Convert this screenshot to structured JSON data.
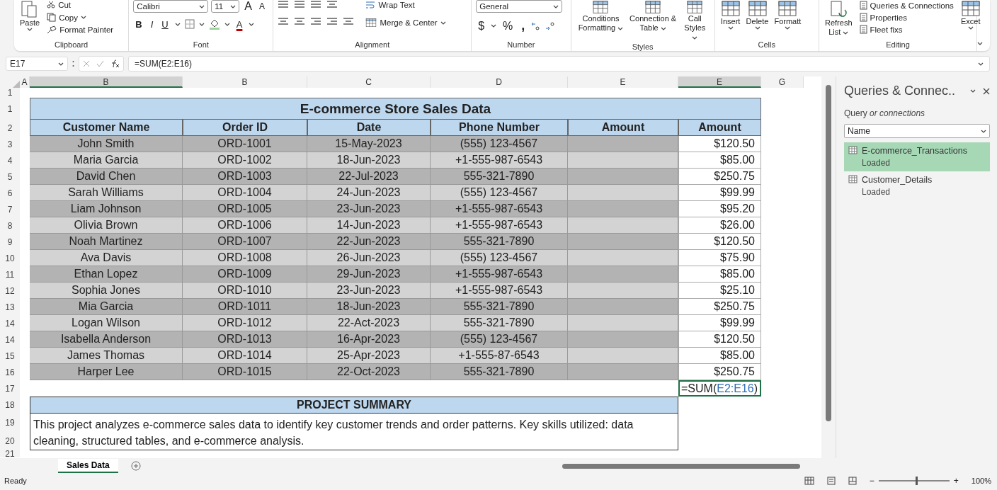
{
  "ribbon": {
    "clipboard": {
      "label": "Clipboard",
      "paste": "Paste",
      "cut": "Cut",
      "copy": "Copy",
      "format_painter": "Format Painter"
    },
    "font": {
      "label": "Font",
      "family": "Calibri",
      "size": "11",
      "grow": "A",
      "shrink": "A",
      "bold": "B",
      "italic": "I",
      "underline": "U",
      "font_color": "A"
    },
    "alignment": {
      "label": "Alignment",
      "wrap_text": "Wrap Text",
      "merge": "Merge & Center"
    },
    "number": {
      "label": "Number",
      "format": "General",
      "currency": "$",
      "percent": "%",
      "comma": ","
    },
    "styles": {
      "label": "Styles",
      "buttons": [
        "Conditions Formatting",
        "Connection & Table",
        "Call Styles"
      ]
    },
    "cells": {
      "label": "Cells",
      "buttons": [
        "Insert",
        "Delete",
        "Formatt"
      ]
    },
    "editing": {
      "label": "Editing",
      "refresh": "Refresh List",
      "links": [
        "Queries & Connections",
        "Properties",
        "Fleet fixs"
      ],
      "extra": "Excet"
    }
  },
  "formula_bar": {
    "name_box": "E17",
    "formula": "=SUM(E2:E16)"
  },
  "sheet": {
    "columns": [
      {
        "label": "A",
        "selected": false
      },
      {
        "label": "B",
        "selected": true
      },
      {
        "label": "B",
        "selected": false
      },
      {
        "label": "C",
        "selected": false
      },
      {
        "label": "D",
        "selected": false
      },
      {
        "label": "E",
        "selected": false
      },
      {
        "label": "E",
        "selected": true
      },
      {
        "label": "G",
        "selected": false
      }
    ],
    "blank_row": "1",
    "title_row": "1",
    "header_row": "2",
    "title": "E-commerce Store Sales Data",
    "headers": [
      "Customer Name",
      "Order ID",
      "Date",
      "Phone Number",
      "Amount",
      "Amount"
    ],
    "rows": [
      {
        "row": "3",
        "name": "John Smith",
        "order_id": "ORD-1001",
        "date": "15-May-2023",
        "phone": "(555) 123-4567",
        "amount": "$120.50"
      },
      {
        "row": "4",
        "name": "Maria Garcia",
        "order_id": "ORD-1002",
        "date": "18-Jun-2023",
        "phone": "+1-555-987-6543",
        "amount": "$85.00"
      },
      {
        "row": "5",
        "name": "David Chen",
        "order_id": "ORD-1003",
        "date": "22-Jul-2023",
        "phone": "555-321-7890",
        "amount": "$250.75"
      },
      {
        "row": "6",
        "name": "Sarah Williams",
        "order_id": "ORD-1004",
        "date": "24-Jun-2023",
        "phone": "(555) 123-4567",
        "amount": "$99.99"
      },
      {
        "row": "7",
        "name": "Liam Johnson",
        "order_id": "ORD-1005",
        "date": "23-Jun-2023",
        "phone": "+1-555-987-6543",
        "amount": "$95.20"
      },
      {
        "row": "8",
        "name": "Olivia Brown",
        "order_id": "ORD-1006",
        "date": "14-Jun-2023",
        "phone": "+1-555-987-6543",
        "amount": "$26.00"
      },
      {
        "row": "9",
        "name": "Noah Martinez",
        "order_id": "ORD-1007",
        "date": "22-Jun-2023",
        "phone": "555-321-7890",
        "amount": "$120.50"
      },
      {
        "row": "10",
        "name": "Ava Davis",
        "order_id": "ORD-1008",
        "date": "26-Jun-2023",
        "phone": "(555) 123-4567",
        "amount": "$75.90"
      },
      {
        "row": "11",
        "name": "Ethan Lopez",
        "order_id": "ORD-1009",
        "date": "29-Jun-2023",
        "phone": "+1-555-987-6543",
        "amount": "$85.00"
      },
      {
        "row": "12",
        "name": "Sophia Jones",
        "order_id": "ORD-1010",
        "date": "23-Jun-2023",
        "phone": "+1-555-987-6543",
        "amount": "$25.10"
      },
      {
        "row": "13",
        "name": "Mia Garcia",
        "order_id": "ORD-1011",
        "date": "18-Jun-2023",
        "phone": "555-321-7890",
        "amount": "$250.75"
      },
      {
        "row": "14",
        "name": "Logan Wilson",
        "order_id": "ORD-1012",
        "date": "22-Act-2023",
        "phone": "555-321-7890",
        "amount": "$99.99"
      },
      {
        "row": "14",
        "name": "Isabella Anderson",
        "order_id": "ORD-1013",
        "date": "16-Apr-2023",
        "phone": "(555) 123-4567",
        "amount": "$120.50"
      },
      {
        "row": "15",
        "name": "James Thomas",
        "order_id": "ORD-1014",
        "date": "25-Apr-2023",
        "phone": "+1-555-87-6543",
        "amount": "$85.00"
      },
      {
        "row": "16",
        "name": "Harper Lee",
        "order_id": "ORD-1015",
        "date": "22-Oct-2023",
        "phone": "555-321-7890",
        "amount": "$250.75"
      }
    ],
    "total": {
      "row": "17",
      "prefix": "=SUM(",
      "ref": "E2:E16",
      "suffix": ")"
    },
    "summary": {
      "header_row": "18",
      "text_rows": [
        "19",
        "20"
      ],
      "last_row": "21",
      "title": "PROJECT SUMMARY",
      "text": "This project analyzes e-commerce sales data to identify key customer trends and order patterns. Key skills utilized: data cleaning, structured tables, and e-commerce analysis."
    }
  },
  "panel": {
    "title": "Queries & Connec..",
    "subtitle": "Query *or connections*",
    "sort": "Name",
    "items": [
      {
        "name": "E-commerce_Transactions",
        "status": "Loaded",
        "selected": true
      },
      {
        "name": "Customer_Details",
        "status": "Loaded",
        "selected": false
      }
    ]
  },
  "sheet_tabs": [
    {
      "label": "Sales Data",
      "selected": true
    }
  ],
  "status_bar": {
    "status": "Ready",
    "zoom": {
      "zoom_out": "−",
      "zoom_in": "+",
      "level": 0.52,
      "reading": "100%"
    }
  }
}
